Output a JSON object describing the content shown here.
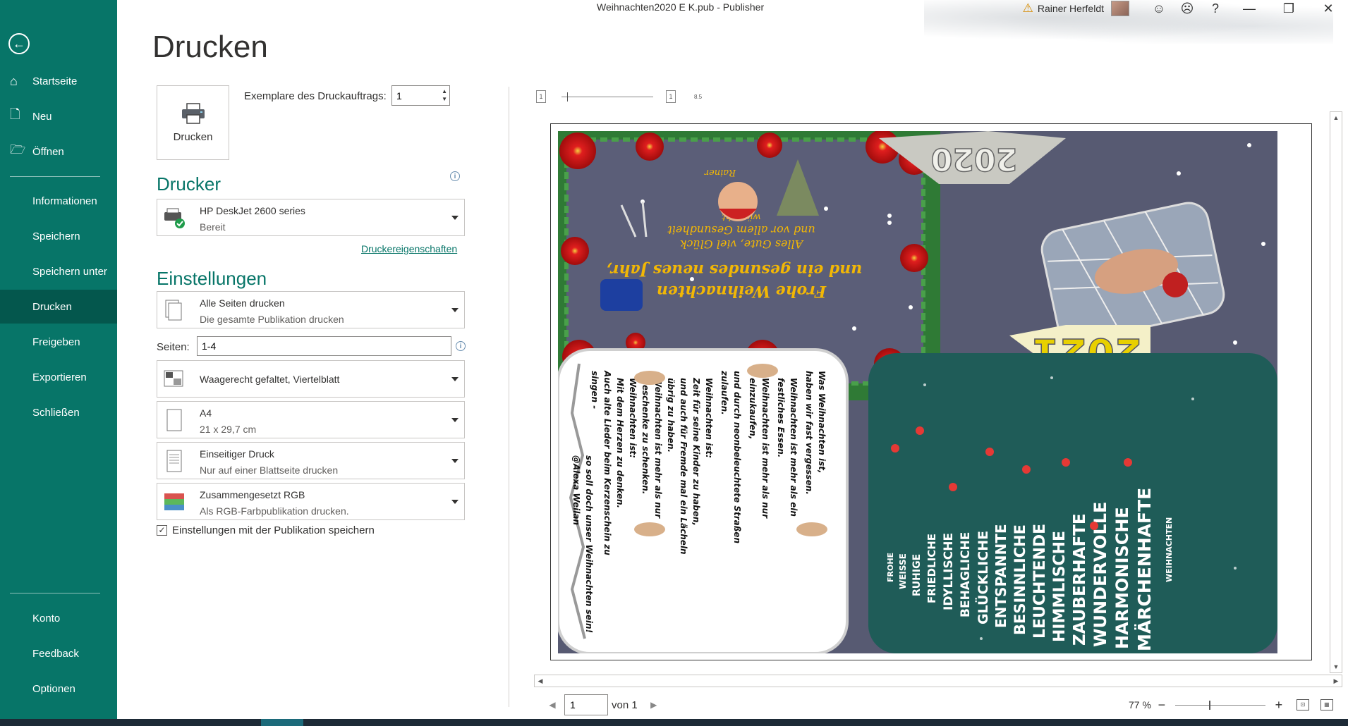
{
  "window": {
    "title": "Weihnachten2020 E K.pub  -  Publisher",
    "user_name": "Rainer Herfeldt",
    "buttons": {
      "help": "?",
      "minimize": "—",
      "restore": "❐",
      "close": "✕"
    }
  },
  "sidebar": {
    "back": "←",
    "top_items": [
      {
        "label": "Startseite",
        "icon": "⌂"
      },
      {
        "label": "Neu",
        "icon": "🗋"
      },
      {
        "label": "Öffnen",
        "icon": "🗁"
      }
    ],
    "middle_items": [
      {
        "label": "Informationen"
      },
      {
        "label": "Speichern"
      },
      {
        "label": "Speichern unter"
      },
      {
        "label": "Drucken"
      },
      {
        "label": "Freigeben"
      },
      {
        "label": "Exportieren"
      },
      {
        "label": "Schließen"
      }
    ],
    "bottom_items": [
      {
        "label": "Konto"
      },
      {
        "label": "Feedback"
      },
      {
        "label": "Optionen"
      }
    ],
    "active": "Drucken"
  },
  "main": {
    "title": "Drucken",
    "print_button": "Drucken",
    "copies_label": "Exemplare des Druckauftrags:",
    "copies_value": "1",
    "printer_heading": "Drucker",
    "printer": {
      "name": "HP DeskJet 2600 series",
      "status": "Bereit"
    },
    "printer_properties": "Druckereigenschaften",
    "settings_heading": "Einstellungen",
    "pages_range": {
      "main": "Alle Seiten drucken",
      "sub": "Die gesamte Publikation drucken"
    },
    "pages_label": "Seiten:",
    "pages_value": "1-4",
    "layout": {
      "main": "Waagerecht gefaltet, Viertelblatt"
    },
    "paper": {
      "main": "A4",
      "sub": "21 x 29,7 cm"
    },
    "sides": {
      "main": "Einseitiger Druck",
      "sub": "Nur auf einer Blattseite drucken"
    },
    "color": {
      "main": "Zusammengesetzt RGB",
      "sub": "Als RGB-Farbpublikation drucken."
    },
    "save_settings": "Einstellungen mit der Publikation speichern",
    "save_settings_checked": true
  },
  "preview": {
    "ruler_label": "8.5",
    "page_number": "1",
    "page_of": "von 1",
    "zoom": "77 %",
    "card": {
      "greeting_1": "Frohe Weihnachten",
      "greeting_2": "und ein gesundes neues Jahr,",
      "greeting_3": "Alles Gute, viel Glück",
      "greeting_4": "und vor allem Gesundheit",
      "greeting_5": "wünscht",
      "signature": "Rainer",
      "year_top": "2020",
      "year_bottom": "2021",
      "poem_col1": [
        "Was Weihnachten ist,",
        "haben wir fast vergessen."
      ],
      "poem_col2": [
        "Weihnachten ist mehr als ein",
        "festliches Essen."
      ],
      "poem_col3": [
        "Weihnachten ist mehr als nur",
        "einzukaufen,"
      ],
      "poem_col4": [
        "und durch neonbeleuchtete Straßen",
        "zulaufen."
      ],
      "poem_col5": [
        "Weihnachten ist:",
        "Zeit für seine Kinder zu haben,"
      ],
      "poem_col6": [
        "und auch für Fremde mal ein Lächeln",
        "übrig zu haben."
      ],
      "poem_col7": [
        "Weihnachten ist mehr als nur",
        "Geschenke zu schenken."
      ],
      "poem_col8": [
        "Weihnachten ist:",
        "Mit dem Herzen zu denken."
      ],
      "poem_col9": [
        "Auch alte Lieder beim Kerzenschein zu",
        "singen -"
      ],
      "poem_col10": [
        "so soll doch unser Weihnachten sein!",
        "@Alexa Weilan"
      ],
      "words": [
        "FROHE",
        "WEISSE",
        "RUHIGE",
        "FRIEDLICHE",
        "IDYLLISCHE",
        "BEHAGLICHE",
        "GLÜCKLICHE",
        "ENTSPANNTE",
        "BESINNLICHE",
        "LEUCHTENDE",
        "HIMMLISCHE",
        "ZAUBERHAFTE",
        "WUNDERVOLLE",
        "HARMONISCHE",
        "MÄRCHENHAFTE",
        "WEIHNACHTEN"
      ]
    }
  },
  "colors": {
    "accent": "#077568",
    "active_nav": "#04574d",
    "card_bg": "#575a72",
    "card_green": "#1f5c58"
  }
}
